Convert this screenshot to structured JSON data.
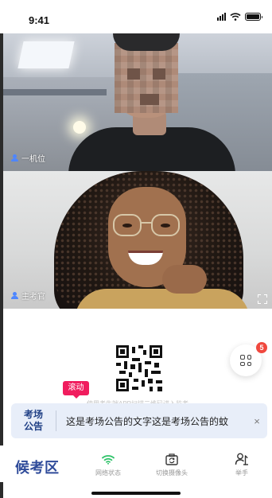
{
  "status_bar": {
    "time": "9:41"
  },
  "videos": [
    {
      "label": "一机位"
    },
    {
      "label": "主考官"
    }
  ],
  "qr_caption": "使用考生端APP扫描二维码进入监考",
  "more_button": {
    "badge": "5"
  },
  "scroll_tag": "滚动",
  "notice": {
    "label_line1": "考场",
    "label_line2": "公告",
    "text": "这是考场公告的文字这是考场公告的蚊",
    "close": "×"
  },
  "bottom_bar": {
    "title": "候考区",
    "tools": [
      {
        "label": "网络状态",
        "icon": "wifi-icon"
      },
      {
        "label": "切换摄像头",
        "icon": "camera-switch-icon"
      },
      {
        "label": "举手",
        "icon": "raise-hand-icon"
      }
    ]
  },
  "colors": {
    "accent": "#2f4b9a",
    "notice_bg": "#e8eef9",
    "tag": "#f01d5e",
    "badge": "#f0483e",
    "wifi": "#2fc36a"
  }
}
